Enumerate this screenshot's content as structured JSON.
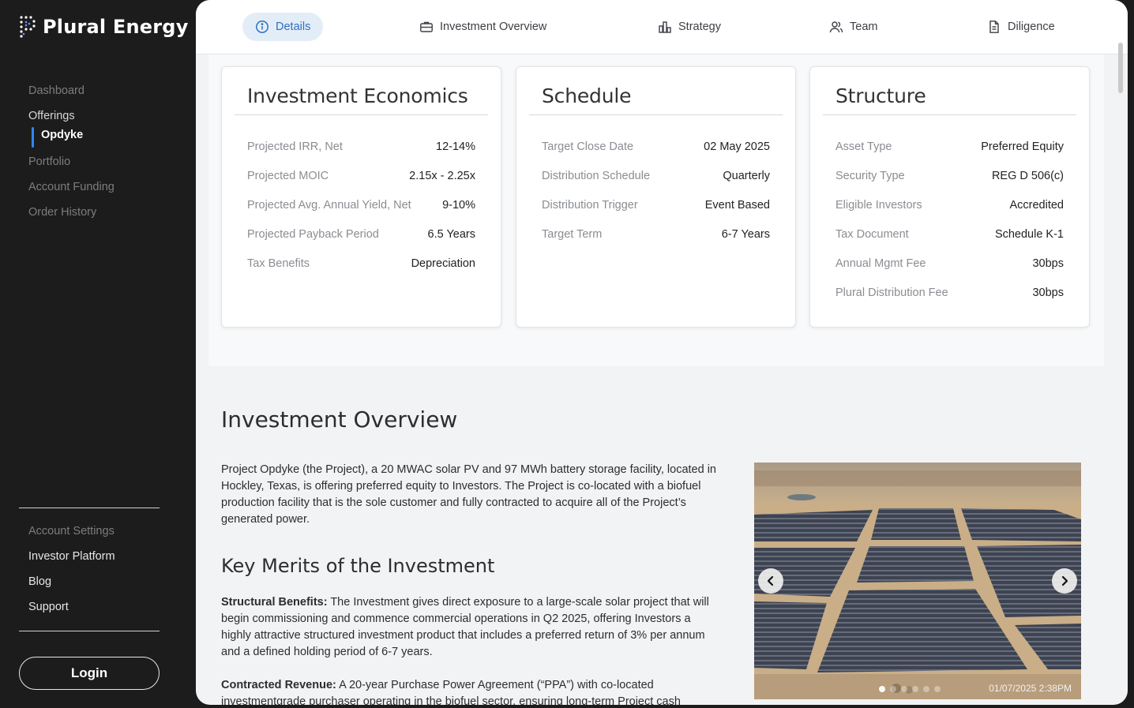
{
  "brand": {
    "name": "Plural Energy"
  },
  "sidebar": {
    "items": [
      {
        "label": "Dashboard"
      },
      {
        "label": "Offerings"
      },
      {
        "label": "Opdyke"
      },
      {
        "label": "Portfolio"
      },
      {
        "label": "Account Funding"
      },
      {
        "label": "Order History"
      }
    ],
    "secondary": [
      {
        "label": "Account Settings"
      },
      {
        "label": "Investor Platform"
      },
      {
        "label": "Blog"
      },
      {
        "label": "Support"
      }
    ],
    "login_label": "Login"
  },
  "tabs": [
    {
      "label": "Details",
      "icon": "info-icon"
    },
    {
      "label": "Investment Overview",
      "icon": "briefcase-icon"
    },
    {
      "label": "Strategy",
      "icon": "bar-chart-icon"
    },
    {
      "label": "Team",
      "icon": "users-icon"
    },
    {
      "label": "Diligence",
      "icon": "document-icon"
    }
  ],
  "cards": [
    {
      "title": "Investment Economics",
      "rows": [
        {
          "k": "Projected IRR, Net",
          "v": "12-14%"
        },
        {
          "k": "Projected MOIC",
          "v": "2.15x - 2.25x"
        },
        {
          "k": "Projected Avg. Annual Yield, Net",
          "v": "9-10%"
        },
        {
          "k": "Projected Payback Period",
          "v": "6.5 Years"
        },
        {
          "k": "Tax Benefits",
          "v": "Depreciation"
        }
      ]
    },
    {
      "title": "Schedule",
      "rows": [
        {
          "k": "Target Close Date",
          "v": "02 May 2025"
        },
        {
          "k": "Distribution Schedule",
          "v": "Quarterly"
        },
        {
          "k": "Distribution Trigger",
          "v": "Event Based"
        },
        {
          "k": "Target Term",
          "v": "6-7 Years"
        }
      ]
    },
    {
      "title": "Structure",
      "rows": [
        {
          "k": "Asset Type",
          "v": "Preferred Equity"
        },
        {
          "k": "Security Type",
          "v": "REG D 506(c)"
        },
        {
          "k": "Eligible Investors",
          "v": "Accredited"
        },
        {
          "k": "Tax Document",
          "v": "Schedule K-1"
        },
        {
          "k": "Annual Mgmt Fee",
          "v": "30bps"
        },
        {
          "k": "Plural Distribution Fee",
          "v": "30bps"
        }
      ]
    }
  ],
  "overview": {
    "title": "Investment Overview",
    "intro": "Project Opdyke (the Project), a 20 MWAC solar PV and 97 MWh battery storage facility, located in Hockley, Texas, is offering preferred equity to Investors. The Project is co-located with a biofuel production facility that is the sole customer and fully contracted to acquire all of the Project’s generated power.",
    "merits_title": "Key Merits of the Investment",
    "merit1_label": "Structural Benefits:",
    "merit1_text": " The Investment gives direct exposure to a large-scale solar project that will begin commissioning and commence commercial operations in Q2 2025, offering Investors a highly attractive structured investment product that includes a preferred return of 3% per annum and a defined holding period of 6-7 years.",
    "merit2_label": "Contracted Revenue:",
    "merit2_text": " A 20-year Purchase Power Agreement (“PPA”) with co-located investmentgrade purchaser operating in the biofuel sector, ensuring long-term Project cash"
  },
  "gallery": {
    "timestamp": "01/07/2025 2:38PM",
    "slide_count": 6,
    "active_slide": 1
  }
}
